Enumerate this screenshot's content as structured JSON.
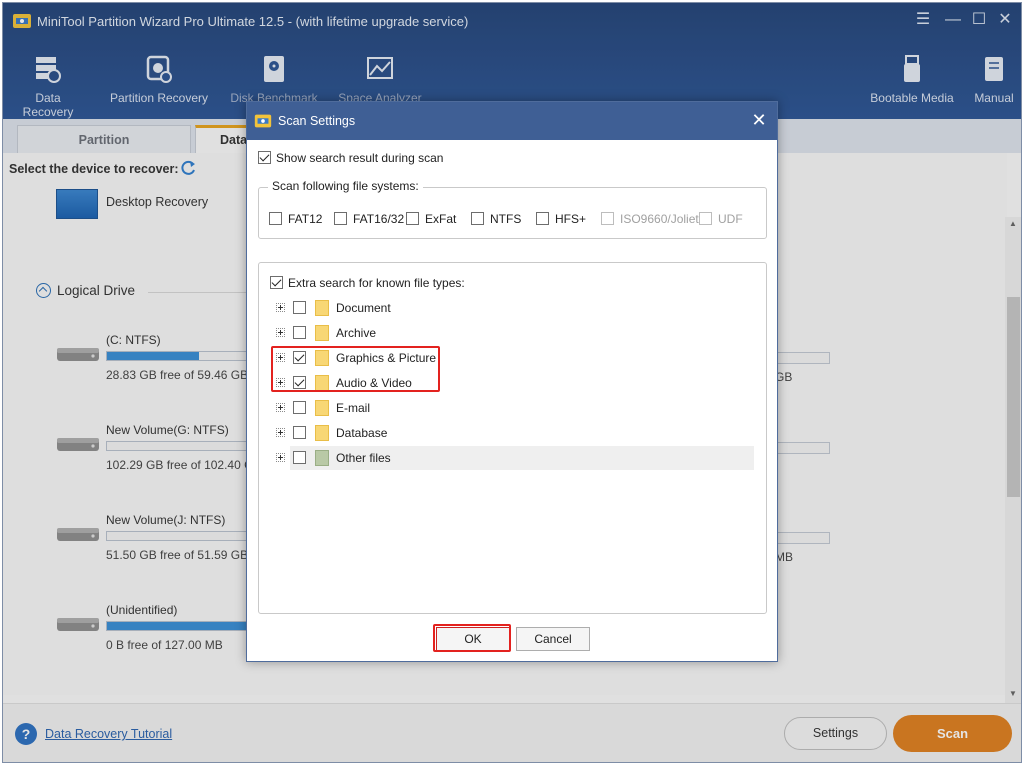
{
  "window": {
    "title": "MiniTool Partition Wizard Pro Ultimate 12.5 - (with lifetime upgrade service)"
  },
  "toolbar": {
    "items": [
      {
        "label": "Data Recovery",
        "icon": "data-recovery-icon"
      },
      {
        "label": "Partition Recovery",
        "icon": "partition-recovery-icon"
      },
      {
        "label": "Disk Benchmark",
        "icon": "disk-benchmark-icon"
      },
      {
        "label": "Space Analyzer",
        "icon": "space-analyzer-icon"
      },
      {
        "label": "Bootable Media",
        "icon": "bootable-media-icon"
      },
      {
        "label": "Manual",
        "icon": "manual-icon"
      }
    ]
  },
  "tabs": [
    {
      "label": "Partition Management"
    },
    {
      "label": "Data Recovery"
    }
  ],
  "main": {
    "select_device": "Select the device to recover:",
    "desktop_recovery": "Desktop Recovery",
    "logical_drive": "Logical Drive",
    "drives": [
      {
        "name": "(C: NTFS)",
        "free": "28.83 GB free of 59.46 GB",
        "used_fraction": 0.52
      },
      {
        "name": "New Volume(G: NTFS)",
        "free": "102.29 GB free of 102.40 GB",
        "used_fraction": 0.0
      },
      {
        "name": "New Volume(J: NTFS)",
        "free": "51.50 GB free of 51.59 GB",
        "used_fraction": 0.0
      },
      {
        "name": "(Unidentified)",
        "free": "0 B free of 127.00 MB",
        "used_fraction": 1.0
      }
    ],
    "right_fragments": [
      "GB",
      "MB"
    ]
  },
  "footer": {
    "tutorial_link": "Data Recovery Tutorial",
    "settings_label": "Settings",
    "scan_label": "Scan"
  },
  "dialog": {
    "title": "Scan Settings",
    "show_result_label": "Show search result during scan",
    "show_result_checked": true,
    "fs_legend": "Scan following file systems:",
    "file_systems": [
      {
        "label": "FAT12",
        "checked": false,
        "enabled": true
      },
      {
        "label": "FAT16/32",
        "checked": false,
        "enabled": true
      },
      {
        "label": "ExFat",
        "checked": false,
        "enabled": true
      },
      {
        "label": "NTFS",
        "checked": false,
        "enabled": true
      },
      {
        "label": "HFS+",
        "checked": false,
        "enabled": true
      },
      {
        "label": "ISO9660/Joliet",
        "checked": false,
        "enabled": false
      },
      {
        "label": "UDF",
        "checked": false,
        "enabled": false
      }
    ],
    "extra_search_label": "Extra search for known file types:",
    "extra_search_checked": true,
    "file_types": [
      {
        "label": "Document",
        "checked": false
      },
      {
        "label": "Archive",
        "checked": false
      },
      {
        "label": "Graphics & Picture",
        "checked": true
      },
      {
        "label": "Audio & Video",
        "checked": true
      },
      {
        "label": "E-mail",
        "checked": false
      },
      {
        "label": "Database",
        "checked": false
      },
      {
        "label": "Other files",
        "checked": false
      }
    ],
    "ok_label": "OK",
    "cancel_label": "Cancel"
  },
  "colors": {
    "titlebar": "#2c5595",
    "dialog_titlebar": "#3f5f95",
    "accent_orange": "#e0801f",
    "highlight_red": "#e3221f",
    "bar_blue": "#3a8fd6"
  }
}
